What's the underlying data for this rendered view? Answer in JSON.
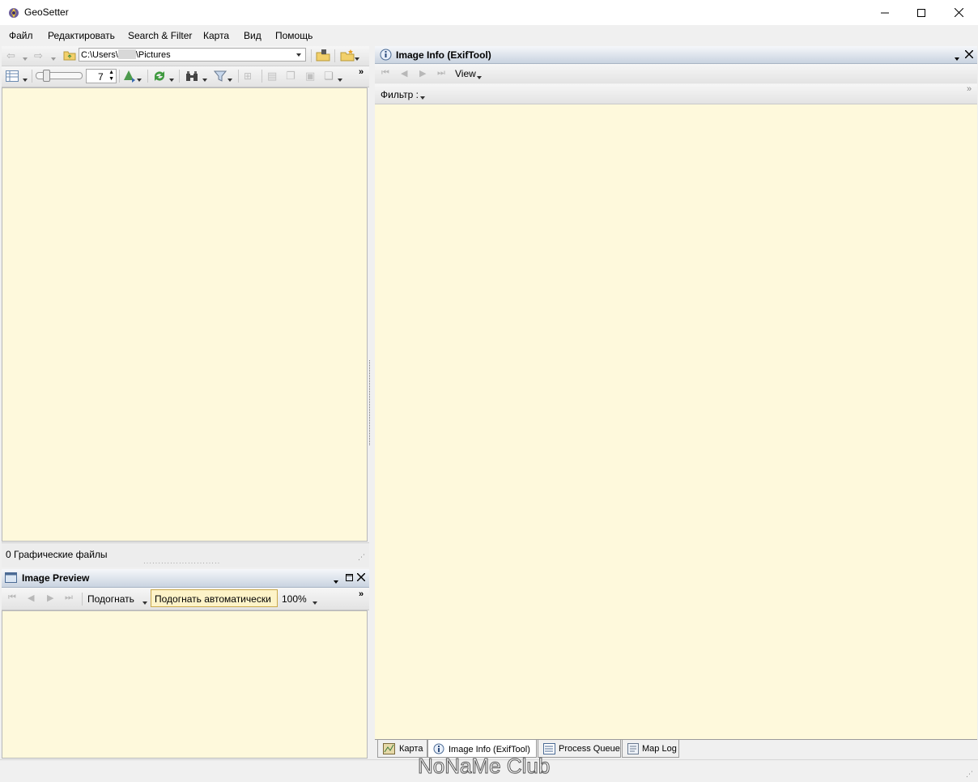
{
  "window": {
    "title": "GeoSetter",
    "controls": [
      "minimize",
      "maximize",
      "close"
    ]
  },
  "menu": [
    "Файл",
    "Редактировать",
    "Search & Filter",
    "Карта",
    "Вид",
    "Помощь"
  ],
  "browser": {
    "path": "C:\\Users\\",
    "path_tail": "\\Pictures",
    "thumb_size": "7",
    "status": "0 Графические файлы"
  },
  "preview": {
    "title": "Image Preview",
    "fit_label": "Подогнать",
    "fit_auto_label": "Подогнать автоматически",
    "zoom": "100%"
  },
  "info": {
    "title": "Image Info (ExifTool)",
    "view_label": "View",
    "filter_label": "Фильтр :"
  },
  "tabs": [
    {
      "label": "Карта",
      "icon": "map-icon"
    },
    {
      "label": "Image Info (ExifTool)",
      "icon": "info-icon"
    },
    {
      "label": "Process Queue",
      "icon": "queue-icon"
    },
    {
      "label": "Map Log",
      "icon": "log-icon"
    }
  ],
  "watermark": "NoNaMe Club",
  "colors": {
    "panel_bg": "#fef9dc",
    "header_gradient_top": "#f5f7fa",
    "header_gradient_bottom": "#c9d3e0"
  }
}
